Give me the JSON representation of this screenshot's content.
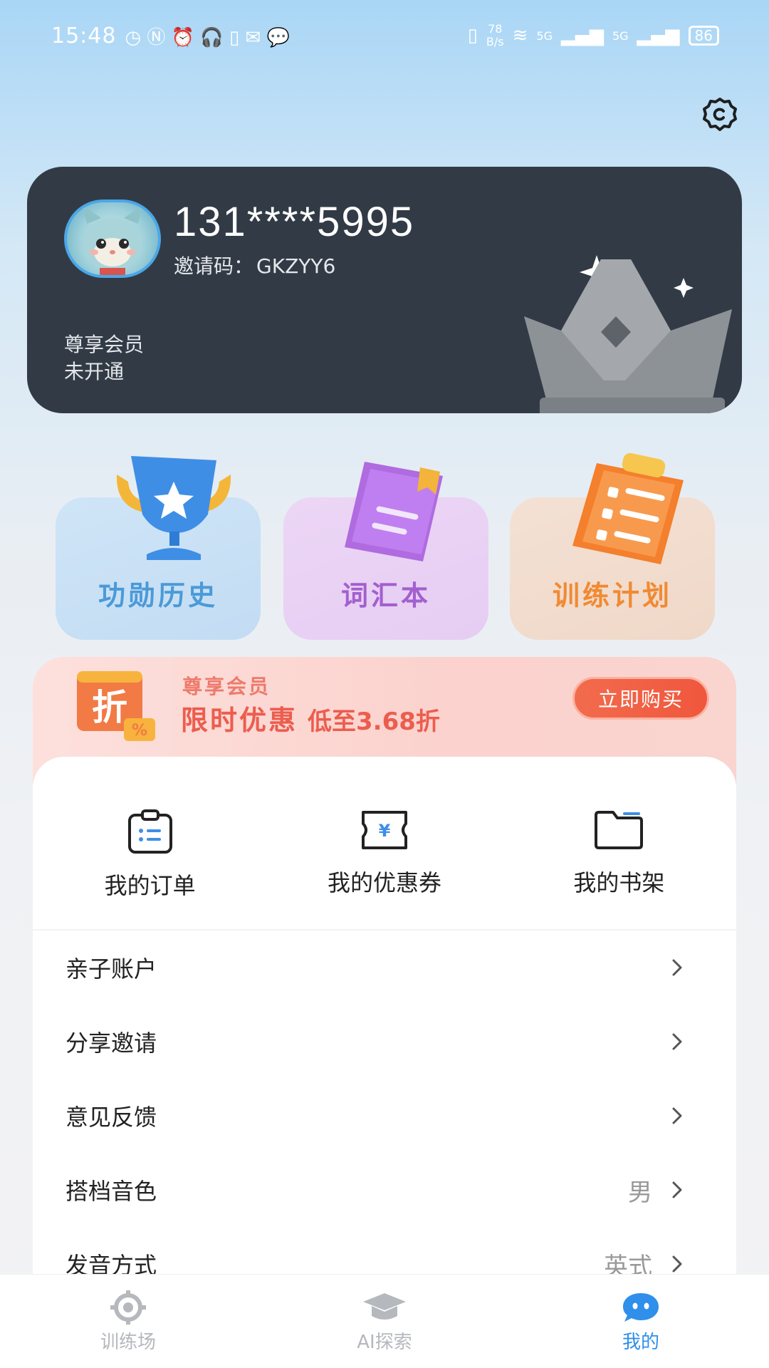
{
  "status_bar": {
    "time": "15:48",
    "net_speed_value": "78",
    "net_speed_unit": "B/s",
    "signal_1": "5G",
    "signal_2": "5G",
    "battery": "86"
  },
  "profile": {
    "phone": "131****5995",
    "invite_label": "邀请码：",
    "invite_code": "GKZYY6",
    "membership_title": "尊享会员",
    "membership_status": "未开通"
  },
  "quick_actions": [
    {
      "label": "功勋历史",
      "icon": "trophy-icon",
      "color": "#4b9ad8"
    },
    {
      "label": "词汇本",
      "icon": "notebook-icon",
      "color": "#a35fcf"
    },
    {
      "label": "训练计划",
      "icon": "checklist-icon",
      "color": "#f08a33"
    }
  ],
  "promo": {
    "badge_char": "折",
    "subtitle": "尊享会员",
    "title": "限时优惠",
    "highlight": "低至3.68折",
    "button": "立即购买"
  },
  "services": [
    {
      "label": "我的订单",
      "icon": "order-icon"
    },
    {
      "label": "我的优惠券",
      "icon": "coupon-icon"
    },
    {
      "label": "我的书架",
      "icon": "folder-icon"
    }
  ],
  "menu": [
    {
      "label": "亲子账户",
      "value": ""
    },
    {
      "label": "分享邀请",
      "value": ""
    },
    {
      "label": "意见反馈",
      "value": ""
    },
    {
      "label": "搭档音色",
      "value": "男"
    },
    {
      "label": "发音方式",
      "value": "英式"
    }
  ],
  "tabs": [
    {
      "label": "训练场",
      "icon": "target-icon",
      "active": false
    },
    {
      "label": "AI探索",
      "icon": "graduation-cap-icon",
      "active": false
    },
    {
      "label": "我的",
      "icon": "chat-bubble-icon",
      "active": true
    }
  ],
  "colors": {
    "accent": "#2f8fea",
    "card_bg": "#323b45",
    "promo_red": "#ec5d4e"
  }
}
